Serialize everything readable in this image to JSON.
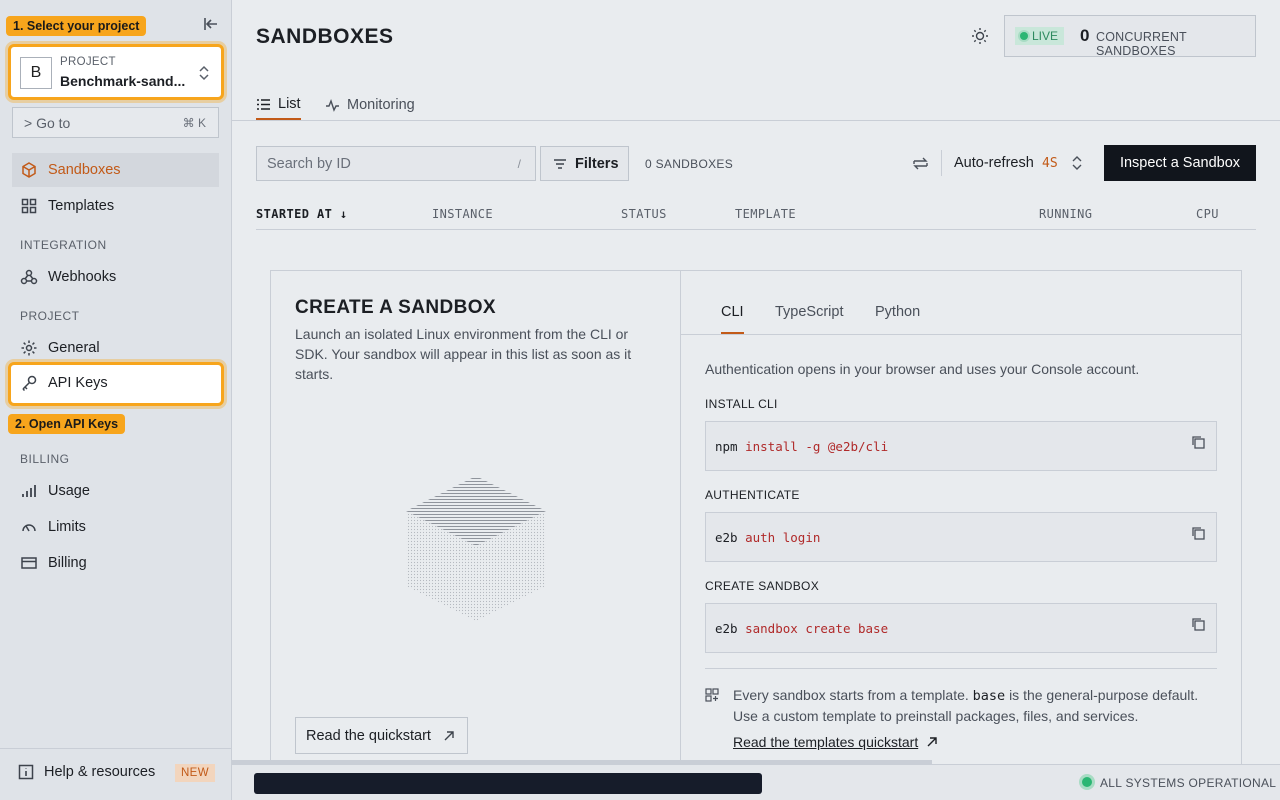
{
  "sidebar": {
    "callout_select_project": "1. Select your project",
    "callout_open_api_keys": "2. Open API Keys",
    "project": {
      "avatar_letter": "B",
      "label": "PROJECT",
      "name": "Benchmark-sand..."
    },
    "goto": {
      "label": "> Go to",
      "shortcut": "⌘ K"
    },
    "items": {
      "sandboxes": "Sandboxes",
      "templates": "Templates",
      "webhooks": "Webhooks",
      "general": "General",
      "api_keys": "API Keys",
      "usage": "Usage",
      "limits": "Limits",
      "billing": "Billing"
    },
    "sections": {
      "integration": "INTEGRATION",
      "project": "PROJECT",
      "billing": "BILLING"
    },
    "help": {
      "label": "Help & resources",
      "badge": "NEW"
    }
  },
  "header": {
    "title": "SANDBOXES",
    "live_label": "LIVE",
    "concurrent_count": "0",
    "concurrent_label": "CONCURRENT SANDBOXES"
  },
  "tabs": {
    "list": "List",
    "monitoring": "Monitoring"
  },
  "toolbar": {
    "search_placeholder": "Search by ID",
    "search_shortcut": "/",
    "filters_label": "Filters",
    "sandbox_count": "0 SANDBOXES",
    "auto_refresh_label": "Auto-refresh",
    "auto_refresh_value": "4S",
    "inspect_button": "Inspect a Sandbox"
  },
  "table": {
    "columns": [
      "STARTED AT",
      "INSTANCE",
      "STATUS",
      "TEMPLATE",
      "RUNNING",
      "CPU"
    ]
  },
  "create": {
    "title": "CREATE A SANDBOX",
    "description": "Launch an isolated Linux environment from the CLI or SDK. Your sandbox will appear in this list as soon as it starts.",
    "quickstart_button": "Read the quickstart",
    "code_tabs": [
      "CLI",
      "TypeScript",
      "Python"
    ],
    "auth_note": "Authentication opens in your browser and uses your Console account.",
    "steps": [
      {
        "label": "INSTALL CLI",
        "cmd": "npm",
        "args": "install -g @e2b/cli"
      },
      {
        "label": "AUTHENTICATE",
        "cmd": "e2b",
        "args": "auth login"
      },
      {
        "label": "CREATE SANDBOX",
        "cmd": "e2b",
        "args": "sandbox create base"
      }
    ],
    "template_note_prefix": "Every sandbox starts from a template.",
    "template_note_code": "base",
    "template_note_suffix": "is the general-purpose default. Use a custom template to preinstall packages, files, and services.",
    "templates_link": "Read the templates quickstart"
  },
  "footer": {
    "status": "ALL SYSTEMS OPERATIONAL"
  },
  "colors": {
    "accent": "#c25a18",
    "callout": "#f7a51c",
    "live": "#2bb673",
    "code_arg": "#b02a2a"
  }
}
